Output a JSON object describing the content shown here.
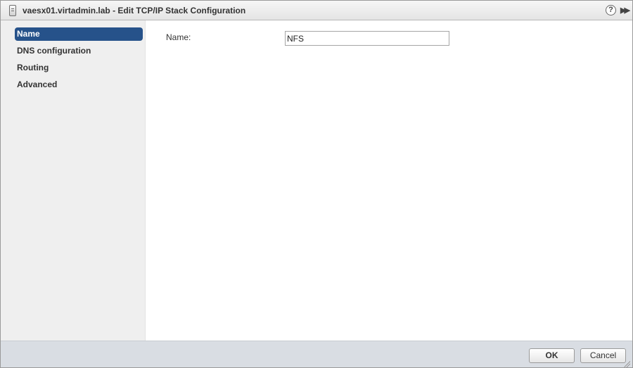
{
  "window": {
    "title": "vaesx01.virtadmin.lab - Edit TCP/IP Stack Configuration",
    "help_glyph": "?",
    "expand_glyph": "▶▶"
  },
  "sidebar": {
    "items": [
      {
        "label": "Name",
        "active": true
      },
      {
        "label": "DNS configuration",
        "active": false
      },
      {
        "label": "Routing",
        "active": false
      },
      {
        "label": "Advanced",
        "active": false
      }
    ]
  },
  "main": {
    "name_label": "Name:",
    "name_value": "NFS"
  },
  "footer": {
    "ok_label": "OK",
    "cancel_label": "Cancel"
  },
  "colors": {
    "active_nav": "#26528a",
    "sidebar_bg": "#efefef",
    "footer_bg": "#d9dde3"
  },
  "icons": {
    "title": "host-server-icon",
    "help": "help-icon",
    "expand": "expand-double-arrow-icon",
    "resize": "resize-grip-icon"
  }
}
